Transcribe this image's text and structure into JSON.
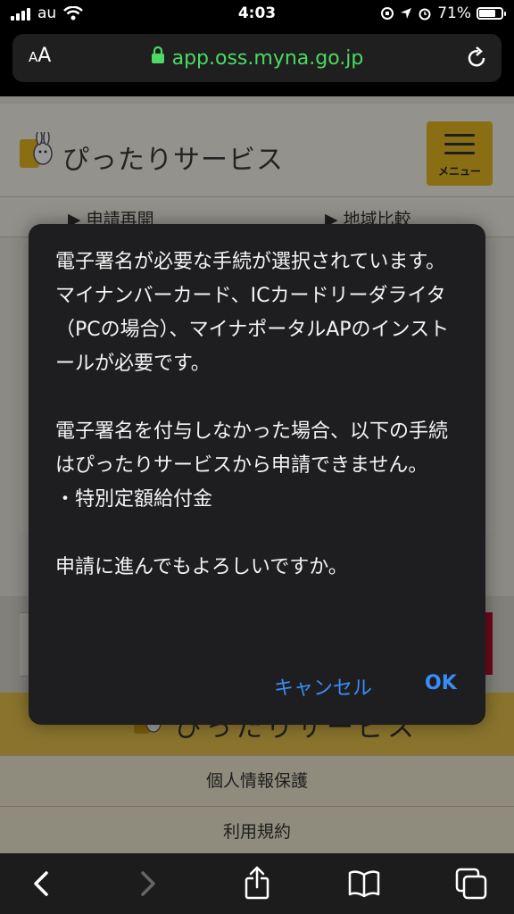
{
  "status_bar": {
    "carrier": "au",
    "time": "4:03",
    "battery": "71%",
    "battery_level": 0.71
  },
  "browser": {
    "text_size_label": "AA",
    "url": "app.oss.myna.go.jp",
    "icons": [
      "lock-icon",
      "reload-icon"
    ]
  },
  "page": {
    "logo_text": "ぴったりサービス",
    "menu_label": "メニュー",
    "subnav": [
      "▶ 申請再開",
      "▶ 地域比較"
    ],
    "footer_logo_text": "ぴったりサービス",
    "footer_links": [
      "個人情報保護",
      "利用規約"
    ]
  },
  "alert": {
    "message": "電子署名が必要な手続が選択されています。\nマイナンバーカード、ICカードリーダライタ（PCの場合）、マイナポータルAPのインストールが必要です。\n\n電子署名を付与しなかった場合、以下の手続はぴったりサービスから申請できません。\n・特別定額給付金\n\n申請に進んでもよろしいですか。",
    "cancel_label": "キャンセル",
    "ok_label": "OK"
  },
  "toolbar": {
    "icons": [
      "back-icon",
      "forward-icon",
      "share-icon",
      "bookmarks-icon",
      "tabs-icon"
    ]
  }
}
